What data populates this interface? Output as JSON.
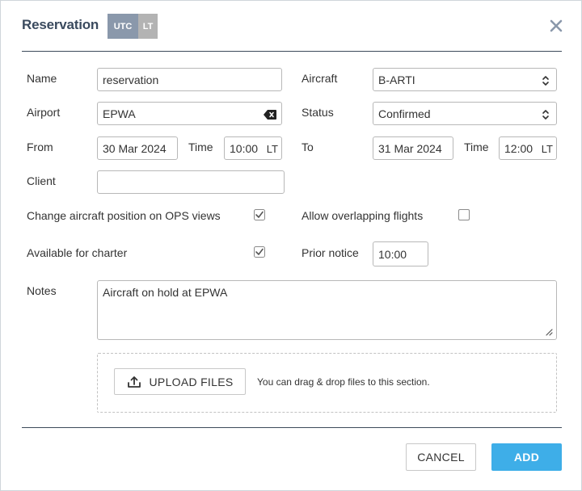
{
  "header": {
    "title": "Reservation",
    "tz_utc": "UTC",
    "tz_lt": "LT",
    "close_icon": "close-icon"
  },
  "form": {
    "name": {
      "label": "Name",
      "value": "reservation"
    },
    "aircraft": {
      "label": "Aircraft",
      "value": "B-ARTI"
    },
    "airport": {
      "label": "Airport",
      "value": "EPWA"
    },
    "status": {
      "label": "Status",
      "value": "Confirmed"
    },
    "from": {
      "label": "From",
      "date": "30 Mar 2024",
      "time_label": "Time",
      "time": "10:00",
      "suffix": "LT"
    },
    "to": {
      "label": "To",
      "date": "31 Mar 2024",
      "time_label": "Time",
      "time": "12:00",
      "suffix": "LT"
    },
    "client": {
      "label": "Client",
      "value": ""
    },
    "change_position": {
      "label": "Change aircraft position on OPS views",
      "checked": true
    },
    "allow_overlap": {
      "label": "Allow overlapping flights",
      "checked": false
    },
    "charter": {
      "label": "Available for charter",
      "checked": true
    },
    "prior_notice": {
      "label": "Prior notice",
      "value": "10:00"
    },
    "notes": {
      "label": "Notes",
      "value": "Aircraft on hold at EPWA"
    }
  },
  "upload": {
    "button_label": "UPLOAD FILES",
    "hint": "You can drag & drop files to this section."
  },
  "footer": {
    "cancel_label": "CANCEL",
    "add_label": "ADD"
  },
  "colors": {
    "title": "#3a4a5e",
    "utc_badge": "#8a98ab",
    "lt_badge": "#b3b3b3",
    "primary": "#3eaee8"
  }
}
